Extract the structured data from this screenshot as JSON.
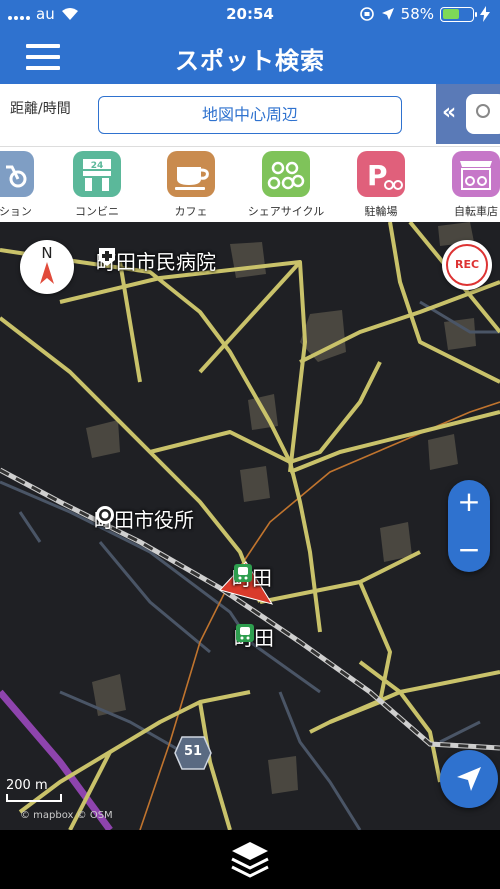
{
  "status_bar": {
    "carrier": "au",
    "time": "20:54",
    "battery": "58%",
    "battery_level": 0.58
  },
  "header": {
    "title": "スポット検索"
  },
  "search": {
    "distance_label": "距離/時間",
    "center_button": "地図中心周辺"
  },
  "categories": [
    {
      "label": "ーション",
      "color": "#7f9ec4",
      "icon": "bicycle-icon"
    },
    {
      "label": "コンビニ",
      "color": "#5bb89a",
      "icon": "convenience-store-icon"
    },
    {
      "label": "カフェ",
      "color": "#c98b4e",
      "icon": "cafe-icon"
    },
    {
      "label": "シェアサイクル",
      "color": "#7fc35a",
      "icon": "share-cycle-icon"
    },
    {
      "label": "駐輪場",
      "color": "#e0607b",
      "icon": "parking-icon"
    },
    {
      "label": "自転車店",
      "color": "#c677c8",
      "icon": "bike-shop-icon"
    }
  ],
  "map": {
    "compass_label": "N",
    "rec_label": "REC",
    "zoom_in": "+",
    "zoom_out": "−",
    "labels": {
      "hospital": "町田市民病院",
      "city_hall": "町田市役所",
      "station1": "町田",
      "station2": "町田"
    },
    "route_number": "51",
    "scale": "200 m",
    "attribution": "© mapbox © OSM"
  }
}
